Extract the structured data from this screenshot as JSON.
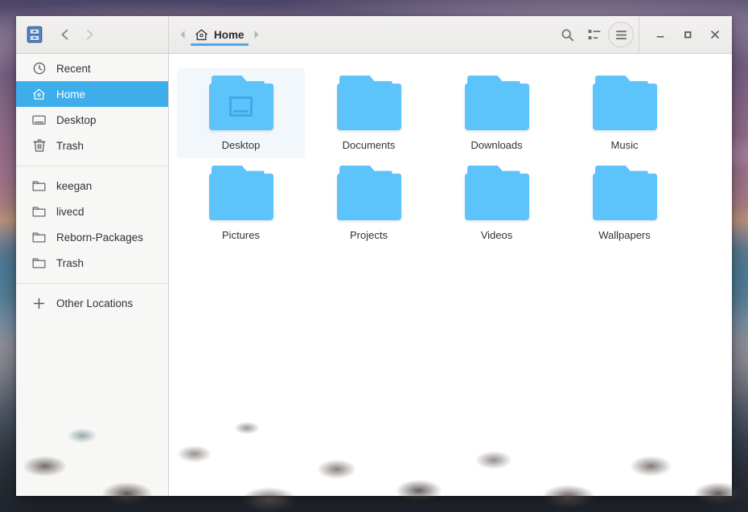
{
  "window": {
    "app_icon": "file-manager-icon",
    "title": "Home"
  },
  "header": {
    "back_label": "Back",
    "forward_label": "Forward",
    "breadcrumb_prev": "previous-path-arrow",
    "breadcrumb_next": "next-path-arrow",
    "breadcrumb": {
      "icon": "home-icon",
      "label": "Home"
    },
    "buttons": {
      "search": "search-icon",
      "view_toggle": "list-view-icon",
      "menu": "hamburger-menu-icon"
    },
    "window_controls": {
      "minimize": "–",
      "maximize": "□",
      "close": "✕"
    }
  },
  "sidebar": {
    "groups": [
      {
        "items": [
          {
            "label": "Recent",
            "icon": "clock-icon",
            "selected": false
          },
          {
            "label": "Home",
            "icon": "home-icon",
            "selected": true
          },
          {
            "label": "Desktop",
            "icon": "monitor-icon",
            "selected": false
          },
          {
            "label": "Trash",
            "icon": "trash-icon",
            "selected": false
          }
        ]
      },
      {
        "items": [
          {
            "label": "keegan",
            "icon": "folder-icon",
            "selected": false
          },
          {
            "label": "livecd",
            "icon": "folder-icon",
            "selected": false
          },
          {
            "label": "Reborn-Packages",
            "icon": "folder-icon",
            "selected": false
          },
          {
            "label": "Trash",
            "icon": "folder-icon",
            "selected": false
          }
        ]
      },
      {
        "items": [
          {
            "label": "Other Locations",
            "icon": "plus-icon",
            "selected": false
          }
        ]
      }
    ]
  },
  "files": {
    "items": [
      {
        "name": "Desktop",
        "type": "folder",
        "emblem": "monitor",
        "selected": true
      },
      {
        "name": "Documents",
        "type": "folder",
        "emblem": null,
        "selected": false
      },
      {
        "name": "Downloads",
        "type": "folder",
        "emblem": null,
        "selected": false
      },
      {
        "name": "Music",
        "type": "folder",
        "emblem": null,
        "selected": false
      },
      {
        "name": "Pictures",
        "type": "folder",
        "emblem": null,
        "selected": false
      },
      {
        "name": "Projects",
        "type": "folder",
        "emblem": null,
        "selected": false
      },
      {
        "name": "Videos",
        "type": "folder",
        "emblem": null,
        "selected": false
      },
      {
        "name": "Wallpapers",
        "type": "folder",
        "emblem": null,
        "selected": false
      }
    ]
  },
  "colors": {
    "accent": "#3daee9",
    "folder": "#5cc4fb",
    "folder_emblem": "#3fa9e8",
    "breadcrumb_underline": "#4aa8e8",
    "headerbar": "#f2f1f0",
    "sidebar_bg": "#f7f7f6",
    "content_bg": "#ffffff"
  }
}
